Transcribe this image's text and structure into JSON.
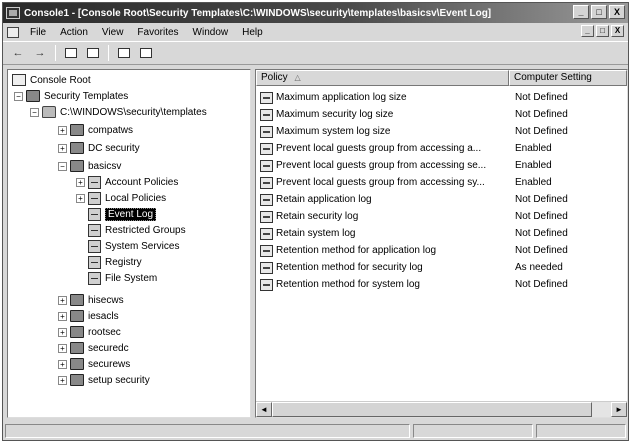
{
  "window": {
    "title": "Console1 - [Console Root\\Security Templates\\C:\\WINDOWS\\security\\templates\\basicsv\\Event Log]",
    "minimize": "_",
    "maximize": "□",
    "close": "X"
  },
  "menu": {
    "items": [
      "File",
      "Action",
      "View",
      "Favorites",
      "Window",
      "Help"
    ],
    "child_minimize": "_",
    "child_restore": "□",
    "child_close": "X"
  },
  "toolbar": {
    "back": "←",
    "forward": "→"
  },
  "tree": {
    "items": [
      {
        "label": "Console Root",
        "expander": "",
        "icon": "console-root-icon"
      },
      {
        "label": "Security Templates",
        "expander": "−",
        "icon": "security-templates-icon"
      },
      {
        "label": "C:\\WINDOWS\\security\\templates",
        "expander": "−",
        "icon": "folder-icon"
      },
      {
        "label": "compatws",
        "expander": "+",
        "icon": "template-icon"
      },
      {
        "label": "DC security",
        "expander": "+",
        "icon": "template-icon"
      },
      {
        "label": "basicsv",
        "expander": "−",
        "icon": "template-icon"
      },
      {
        "label": "Account Policies",
        "expander": "+",
        "icon": "policy-folder-icon"
      },
      {
        "label": "Local Policies",
        "expander": "+",
        "icon": "policy-folder-icon"
      },
      {
        "label": "Event Log",
        "expander": "",
        "icon": "event-log-icon"
      },
      {
        "label": "Restricted Groups",
        "expander": "",
        "icon": "restricted-groups-icon"
      },
      {
        "label": "System Services",
        "expander": "",
        "icon": "system-services-icon"
      },
      {
        "label": "Registry",
        "expander": "",
        "icon": "registry-icon"
      },
      {
        "label": "File System",
        "expander": "",
        "icon": "file-system-icon"
      },
      {
        "label": "hisecws",
        "expander": "+",
        "icon": "template-icon"
      },
      {
        "label": "iesacls",
        "expander": "+",
        "icon": "template-icon"
      },
      {
        "label": "rootsec",
        "expander": "+",
        "icon": "template-icon"
      },
      {
        "label": "securedc",
        "expander": "+",
        "icon": "template-icon"
      },
      {
        "label": "securews",
        "expander": "+",
        "icon": "template-icon"
      },
      {
        "label": "setup security",
        "expander": "+",
        "icon": "template-icon"
      }
    ]
  },
  "list": {
    "col_policy": "Policy",
    "col_setting": "Computer Setting",
    "sort_indicator": "△",
    "rows": [
      {
        "policy": "Maximum application log size",
        "setting": "Not Defined"
      },
      {
        "policy": "Maximum security log size",
        "setting": "Not Defined"
      },
      {
        "policy": "Maximum system log size",
        "setting": "Not Defined"
      },
      {
        "policy": "Prevent local guests group from accessing a...",
        "setting": "Enabled"
      },
      {
        "policy": "Prevent local guests group from accessing se...",
        "setting": "Enabled"
      },
      {
        "policy": "Prevent local guests group from accessing sy...",
        "setting": "Enabled"
      },
      {
        "policy": "Retain application log",
        "setting": "Not Defined"
      },
      {
        "policy": "Retain security log",
        "setting": "Not Defined"
      },
      {
        "policy": "Retain system log",
        "setting": "Not Defined"
      },
      {
        "policy": "Retention method for application log",
        "setting": "Not Defined"
      },
      {
        "policy": "Retention method for security log",
        "setting": "As needed"
      },
      {
        "policy": "Retention method for system log",
        "setting": "Not Defined"
      }
    ]
  },
  "scroll": {
    "left": "◄",
    "right": "►"
  }
}
